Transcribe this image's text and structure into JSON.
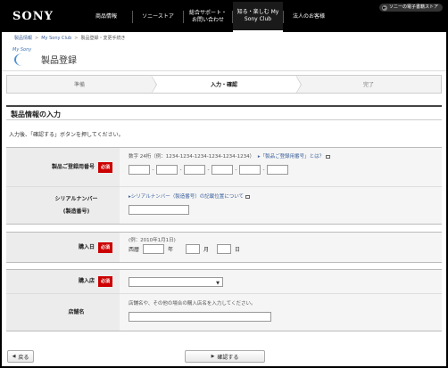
{
  "brand": {
    "logo": "SONY"
  },
  "gnav": {
    "items": [
      {
        "label": "商品情報"
      },
      {
        "label": "ソニーストア"
      },
      {
        "label": "総合サポート・お問い合わせ"
      },
      {
        "label": "知る・楽しむ My Sony Club"
      },
      {
        "label": "法人のお客様"
      }
    ],
    "store_button": "ソニーの電子書籍ストア"
  },
  "breadcrumb": [
    "製品情報",
    "My Sony Club",
    "製品登録・変更手続き"
  ],
  "page": {
    "ms_logo": "My Sony",
    "title": "製品登録"
  },
  "steps": [
    {
      "label": "準備"
    },
    {
      "label": "入力・確認"
    },
    {
      "label": "完了"
    }
  ],
  "section": {
    "title": "製品情報の入力",
    "instruction": "入力後、「確認する」ボタンを押してください。"
  },
  "form": {
    "required_label": "必須",
    "reg_number": {
      "label": "製品ご登録用番号",
      "hint": "数字 24桁（例：1234-1234-1234-1234-1234-1234）",
      "help": "「製品ご登録用番号」とは？",
      "dash": "-"
    },
    "serial": {
      "label_line1": "シリアルナンバー",
      "label_line2": "(製造番号)",
      "help": "シリアルナンバー（製造番号）の記載位置について",
      "value": ""
    },
    "purchase_date": {
      "label": "購入日",
      "hint": "(例：2010年1月1日)",
      "era": "西暦",
      "year": "年",
      "month": "月",
      "day": "日"
    },
    "store": {
      "label": "購入店",
      "selected": ""
    },
    "store_name": {
      "label": "店舗名",
      "hint": "店舗名や、その他の場合の購入店名を入力してください。",
      "value": ""
    }
  },
  "buttons": {
    "back": "戻る",
    "confirm": "確認する"
  }
}
